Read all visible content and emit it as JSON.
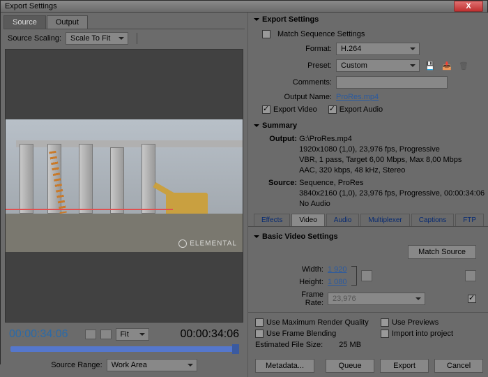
{
  "window_title": "Export Settings",
  "left": {
    "tabs": [
      "Source",
      "Output"
    ],
    "active_tab": 1,
    "source_scaling_label": "Source Scaling:",
    "source_scaling_value": "Scale To Fit",
    "watermark": "ELEMENTAL",
    "left_timecode": "00:00:34:06",
    "fit_label": "Fit",
    "right_timecode": "00:00:34:06",
    "source_range_label": "Source Range:",
    "source_range_value": "Work Area"
  },
  "export": {
    "header": "Export Settings",
    "match_seq_label": "Match Sequence Settings",
    "format_label": "Format:",
    "format_value": "H.264",
    "preset_label": "Preset:",
    "preset_value": "Custom",
    "comments_label": "Comments:",
    "output_name_label": "Output Name:",
    "output_name_value": "ProRes.mp4",
    "export_video_label": "Export Video",
    "export_audio_label": "Export Audio"
  },
  "summary": {
    "header": "Summary",
    "output_label": "Output:",
    "output_lines": [
      "G:\\ProRes.mp4",
      "1920x1080 (1,0), 23,976 fps, Progressive",
      "VBR, 1 pass, Target 6,00 Mbps, Max 8,00 Mbps",
      "AAC, 320 kbps, 48 kHz, Stereo"
    ],
    "source_label": "Source:",
    "source_lines": [
      "Sequence, ProRes",
      "3840x2160 (1,0), 23,976 fps, Progressive, 00:00:34:06",
      "No Audio"
    ]
  },
  "sub_tabs": [
    "Effects",
    "Video",
    "Audio",
    "Multiplexer",
    "Captions",
    "FTP"
  ],
  "sub_tab_active": 1,
  "video": {
    "header": "Basic Video Settings",
    "match_source_btn": "Match Source",
    "width_label": "Width:",
    "width_value": "1 920",
    "height_label": "Height:",
    "height_value": "1 080",
    "frame_rate_label": "Frame Rate:",
    "frame_rate_value": "23,976"
  },
  "bottom": {
    "use_max_render": "Use Maximum Render Quality",
    "use_previews": "Use Previews",
    "use_frame_blend": "Use Frame Blending",
    "import_proj": "Import into project",
    "est_size_label": "Estimated File Size:",
    "est_size_value": "25 MB",
    "btn_metadata": "Metadata...",
    "btn_queue": "Queue",
    "btn_export": "Export",
    "btn_cancel": "Cancel"
  }
}
